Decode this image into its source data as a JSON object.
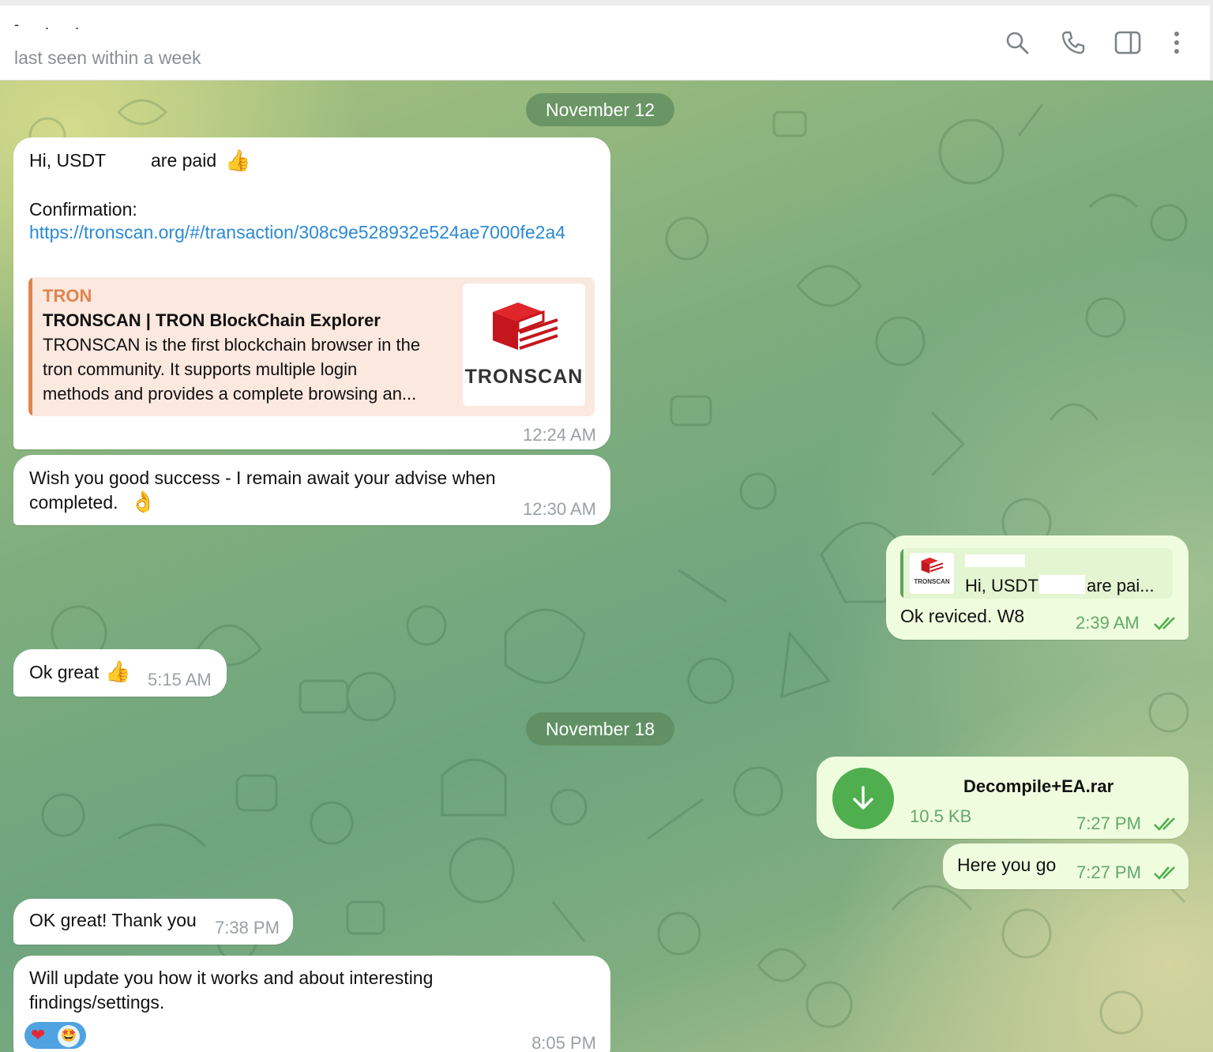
{
  "header": {
    "chat_name": "- . .",
    "status": "last seen within a week",
    "icons": [
      "search-icon",
      "phone-icon",
      "sidebar-toggle-icon",
      "more-vertical-icon"
    ]
  },
  "dates": {
    "first": "November 12",
    "second": "November 18"
  },
  "messages": {
    "m1": {
      "line1_a": "Hi, USDT",
      "line1_b": "are paid",
      "emoji1": "👍",
      "line2": "Confirmation:",
      "link": "https://tronscan.org/#/transaction/308c9e528932e524ae7000fe2a4",
      "preview": {
        "site": "TRON",
        "title": "TRONSCAN | TRON BlockChain Explorer",
        "desc_line1": "TRONSCAN is the first blockchain browser in the",
        "desc_line2": "tron community. It supports multiple login",
        "desc_line3": "methods and provides a complete browsing an...",
        "logo_text": "TRONSCAN"
      },
      "time": "12:24 AM"
    },
    "m2": {
      "line1": "Wish you good success - I remain await your advise when",
      "line2": "completed.",
      "emoji": "👌",
      "time": "12:30 AM"
    },
    "m3": {
      "reply_preview_text": "Hi, USDT",
      "reply_logo_text": "TRONSCAN",
      "reply_trail": "are pai...",
      "text": "Ok reviced. W8",
      "time": "2:39 AM"
    },
    "m4": {
      "text": "Ok great",
      "emoji": "👍",
      "time": "5:15 AM"
    },
    "m5": {
      "file_name": "Decompile+EA.rar",
      "file_size": "10.5 KB",
      "time": "7:27 PM"
    },
    "m6": {
      "text": "Here you go",
      "time": "7:27 PM"
    },
    "m7": {
      "text": "OK great! Thank you",
      "time": "7:38 PM"
    },
    "m8": {
      "line1": "Will update you how it works and about interesting",
      "line2": "findings/settings.",
      "reactions": [
        "❤",
        "🤩"
      ],
      "time": "8:05 PM"
    }
  },
  "colors": {
    "accent_green": "#4fae4e",
    "link_blue": "#2a8ad6",
    "preview_orange": "#e0844e",
    "outgoing_bubble": "#effdde",
    "incoming_bubble": "#ffffff"
  }
}
